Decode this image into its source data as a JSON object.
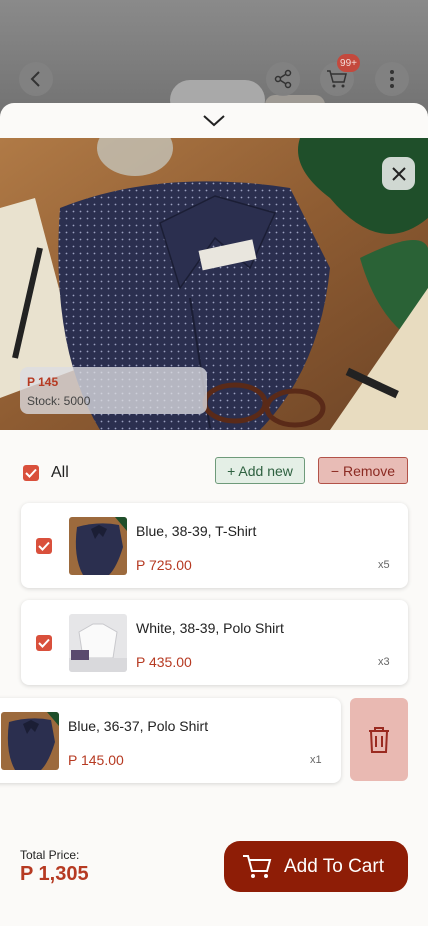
{
  "background_header": {
    "cart_badge": "99+",
    "icons": [
      "back-icon",
      "share-icon",
      "cart-icon",
      "more-icon"
    ]
  },
  "sheet": {
    "collapse_icon": "chevron-down-icon",
    "close_icon": "close-icon"
  },
  "product": {
    "price_label": "P 145",
    "stock_label": "Stock: 5000"
  },
  "selection": {
    "all_label": "All",
    "add_new_label": "+ Add new",
    "remove_label": "− Remove"
  },
  "items": [
    {
      "name": "Blue, 38-39, T-Shirt",
      "price": "P 725.00",
      "qty": "x5",
      "checked": true,
      "thumb": "navy-shirt"
    },
    {
      "name": "White, 38-39, Polo Shirt",
      "price": "P 435.00",
      "qty": "x3",
      "checked": true,
      "thumb": "white-shirt"
    },
    {
      "name": "Blue, 36-37, Polo Shirt",
      "price": "P 145.00",
      "qty": "x1",
      "checked": false,
      "thumb": "navy-shirt"
    }
  ],
  "footer": {
    "total_label": "Total Price:",
    "total_value": "P 1,305",
    "add_to_cart_label": "Add To Cart"
  },
  "colors": {
    "accent": "#b63a22",
    "cart_button": "#8e1d06",
    "checkbox": "#d9503c",
    "add_button_bg": "#e4efe6",
    "remove_button_bg": "#e8bcb6"
  }
}
